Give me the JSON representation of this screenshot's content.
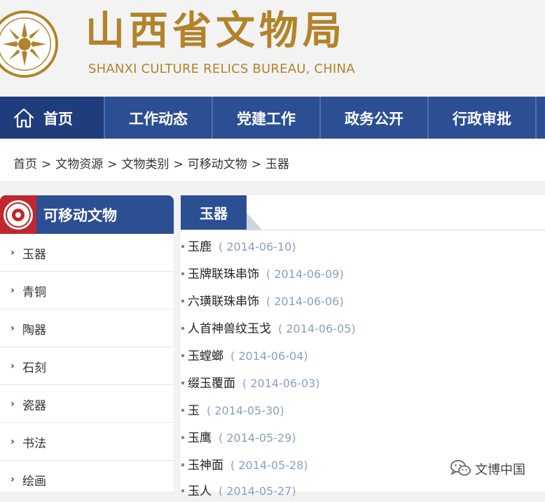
{
  "header": {
    "title": "山西省文物局",
    "subtitle": "SHANXI CULTURE RELICS BUREAU, CHINA",
    "logo_icon": "cultural-heritage-logo-icon",
    "brand_color": "#b2832a"
  },
  "nav": {
    "home_label": "首页",
    "home_icon": "home-icon",
    "items": [
      "工作动态",
      "党建工作",
      "政务公开",
      "行政审批"
    ],
    "color": "#2c4f94"
  },
  "breadcrumb": [
    "首页",
    "文物资源",
    "文物类别",
    "可移动文物",
    "玉器"
  ],
  "sidebar": {
    "title": "可移动文物",
    "items": [
      "玉器",
      "青铜",
      "陶器",
      "石刻",
      "瓷器",
      "书法",
      "绘画"
    ]
  },
  "main": {
    "tab": "玉器",
    "list": [
      {
        "title": "玉鹿",
        "date": "( 2014-06-10)"
      },
      {
        "title": "玉牌联珠串饰",
        "date": "( 2014-06-09)"
      },
      {
        "title": "六璜联珠串饰",
        "date": "( 2014-06-06)"
      },
      {
        "title": "人首神兽纹玉戈",
        "date": "( 2014-06-05)"
      },
      {
        "title": "玉螳螂",
        "date": "( 2014-06-04)"
      },
      {
        "title": "缀玉覆面",
        "date": "( 2014-06-03)"
      },
      {
        "title": "玉",
        "date": "( 2014-05-30)"
      },
      {
        "title": "玉鹰",
        "date": "( 2014-05-29)"
      },
      {
        "title": "玉神面",
        "date": "( 2014-05-28)"
      },
      {
        "title": "玉人",
        "date": "( 2014-05-27)"
      }
    ]
  },
  "watermark": {
    "text": "文博中国",
    "icon": "wechat-icon"
  }
}
